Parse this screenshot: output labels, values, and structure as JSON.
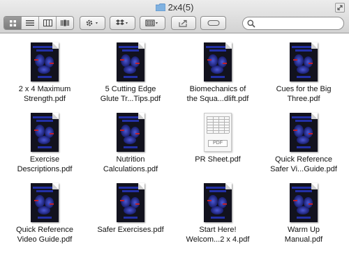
{
  "window": {
    "title": "2x4(5)"
  },
  "search": {
    "placeholder": ""
  },
  "files": [
    {
      "name": "2 x 4 Maximum\nStrength.pdf",
      "thumb": "book"
    },
    {
      "name": "5 Cutting Edge\nGlute Tr...Tips.pdf",
      "thumb": "book"
    },
    {
      "name": "Biomechanics of\nthe Squa...dlift.pdf",
      "thumb": "book"
    },
    {
      "name": "Cues for the Big\nThree.pdf",
      "thumb": "book"
    },
    {
      "name": "Exercise\nDescriptions.pdf",
      "thumb": "book"
    },
    {
      "name": "Nutrition\nCalculations.pdf",
      "thumb": "book"
    },
    {
      "name": "PR Sheet.pdf",
      "thumb": "sheet"
    },
    {
      "name": "Quick Reference\nSafer Vi...Guide.pdf",
      "thumb": "book"
    },
    {
      "name": "Quick Reference\nVideo Guide.pdf",
      "thumb": "book"
    },
    {
      "name": "Safer Exercises.pdf",
      "thumb": "book"
    },
    {
      "name": "Start Here!\nWelcom...2 x 4.pdf",
      "thumb": "book"
    },
    {
      "name": "Warm Up\nManual.pdf",
      "thumb": "book"
    }
  ],
  "sheet_icon_text": "PDF",
  "colors": {
    "toolbar_top": "#ececec",
    "toolbar_bottom": "#d3d3d3",
    "cover_dark": "#12121e",
    "cover_blue": "#2330a6",
    "cover_red": "#c0202a"
  }
}
